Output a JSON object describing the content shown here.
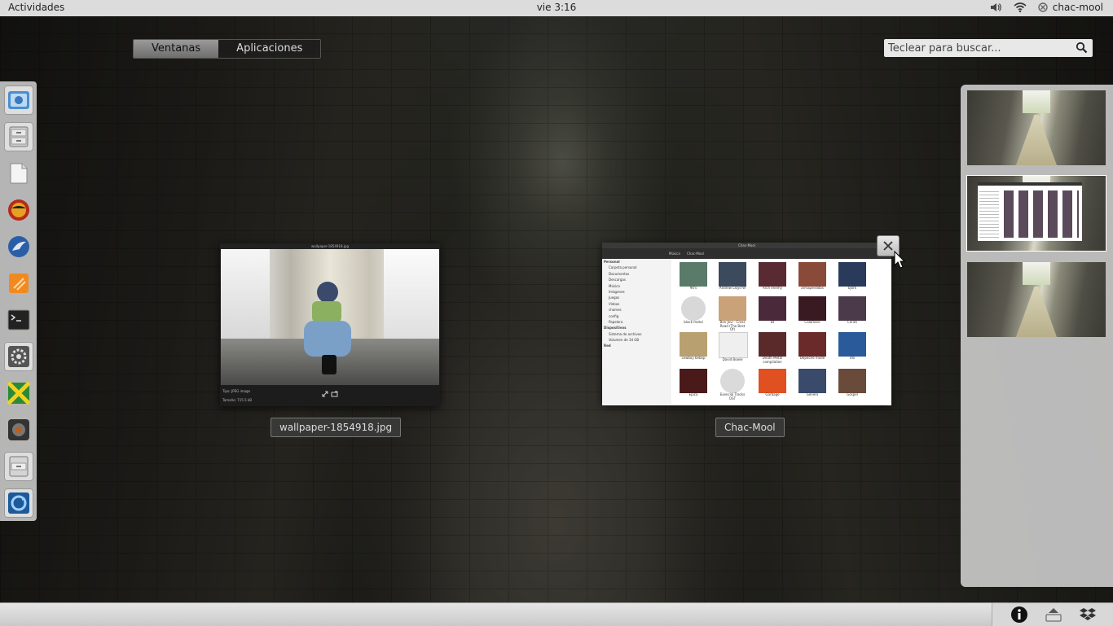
{
  "top_bar": {
    "activities": "Actividades",
    "clock": "vie  3:16",
    "user": "chac-mool"
  },
  "view_selector": {
    "tabs": [
      "Ventanas",
      "Aplicaciones"
    ],
    "active": "Ventanas"
  },
  "search": {
    "placeholder": "Teclear para buscar..."
  },
  "dash": {
    "items": [
      {
        "name": "chromium",
        "icon": "chromium-icon",
        "running": true
      },
      {
        "name": "file-cabinet",
        "icon": "file-cabinet-icon",
        "running": true
      },
      {
        "name": "text-editor",
        "icon": "text-editor-icon",
        "running": false
      },
      {
        "name": "media-player",
        "icon": "media-player-icon",
        "running": false
      },
      {
        "name": "thunderbird",
        "icon": "mail-icon",
        "running": false
      },
      {
        "name": "sublime",
        "icon": "code-editor-icon",
        "running": false
      },
      {
        "name": "terminal",
        "icon": "terminal-icon",
        "running": false
      },
      {
        "name": "settings",
        "icon": "settings-icon",
        "running": true
      },
      {
        "name": "music-player",
        "icon": "music-player-icon",
        "running": false
      },
      {
        "name": "camera",
        "icon": "camera-icon",
        "running": false
      },
      {
        "name": "archive",
        "icon": "archive-icon",
        "running": true
      },
      {
        "name": "updater",
        "icon": "updater-icon",
        "running": true
      }
    ]
  },
  "windows": {
    "image_viewer": {
      "caption": "wallpaper-1854918.jpg",
      "title": "wallpaper-1854918.jpg",
      "info_type": "Tipo: JPEG image",
      "info_size": "Tamaño: 715.5 kB"
    },
    "file_manager": {
      "caption": "Chac-Mool",
      "title": "Chac-Mool",
      "breadcrumb": [
        "Música",
        "Chac-Mool"
      ],
      "sidebar": {
        "personal_header": "Personal",
        "personal": [
          "Carpeta personal",
          "Documentos",
          "Descargas",
          "Música",
          "Imágenes",
          "Juegos",
          "Vídeos",
          "chames",
          "config",
          "Papelera"
        ],
        "devices_header": "Dispositivos",
        "devices": [
          "Sistema de archivos",
          "Volumen de 34 GB"
        ],
        "network_header": "Red"
      },
      "albums": [
        {
          "label": "90's",
          "color": "#5a7a6a"
        },
        {
          "label": "Andrew Lloyd W",
          "color": "#3b4a5c"
        },
        {
          "label": "Arch enemy",
          "color": "#5a2a33"
        },
        {
          "label": "armaperdidas",
          "color": "#8a4a3a"
        },
        {
          "label": "bjork",
          "color": "#2a3a5a"
        },
        {
          "label": "black metal",
          "color": "#d8d8d8"
        },
        {
          "label": "Bon Jovi - Cross Road (The Best Of)",
          "color": "#c9a27a"
        },
        {
          "label": "Bt",
          "color": "#4a2a3a"
        },
        {
          "label": "Calamaro",
          "color": "#3a1a22"
        },
        {
          "label": "Cerati",
          "color": "#4a3a4a"
        },
        {
          "label": "cowboy bebop",
          "color": "#b8a070"
        },
        {
          "label": "David Bowie",
          "color": "#efefef"
        },
        {
          "label": "Death Metal compilation",
          "color": "#5a2a2a"
        },
        {
          "label": "Depeche mode",
          "color": "#6a2a2a"
        },
        {
          "label": "elo",
          "color": "#2a5a9a"
        },
        {
          "label": "Epica",
          "color": "#4a1a1a"
        },
        {
          "label": "Esencial Tracks OST",
          "color": "#dadada"
        },
        {
          "label": "Garbage",
          "color": "#e05020"
        },
        {
          "label": "Genero",
          "color": "#3a4a6a"
        },
        {
          "label": "Gospel",
          "color": "#6a4a3a"
        }
      ]
    }
  },
  "workspaces": {
    "count": 3,
    "active_index": 1
  },
  "bottom_tray": {
    "icons": [
      "info-icon",
      "eject-icon",
      "dropbox-icon"
    ]
  },
  "colors": {
    "top_bar_bg": "#dcdcdc",
    "active_tab": "#8a8a8a",
    "panel_bg": "#d7d7d7"
  }
}
